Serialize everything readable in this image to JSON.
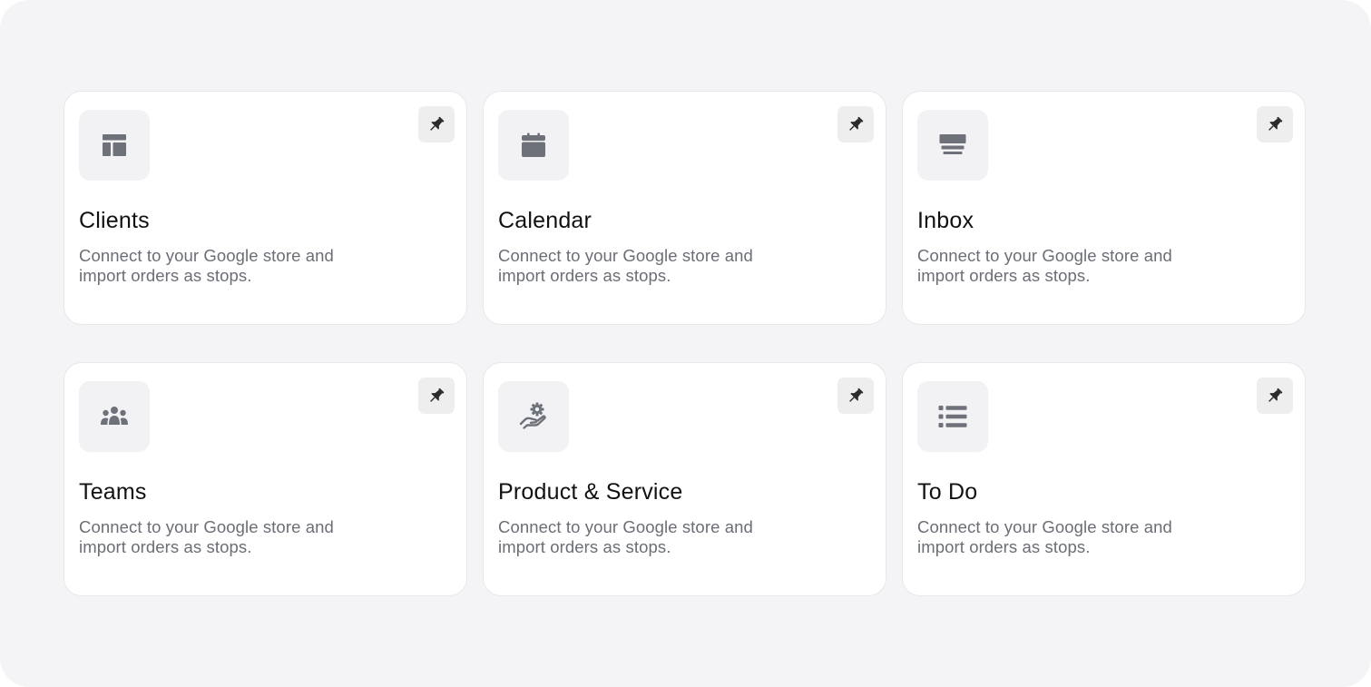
{
  "colors": {
    "background": "#f4f4f6",
    "card": "#ffffff",
    "icon": "#6e717a",
    "pin": "#2b2b2e"
  },
  "cards": [
    {
      "title": "Clients",
      "description": "Connect to your Google store and import orders as stops.",
      "icon": "layout-icon"
    },
    {
      "title": "Calendar",
      "description": "Connect to your Google store and import orders as stops.",
      "icon": "calendar-icon"
    },
    {
      "title": "Inbox",
      "description": "Connect to your Google store and import orders as stops.",
      "icon": "inbox-icon"
    },
    {
      "title": "Teams",
      "description": "Connect to your Google store and import orders as stops.",
      "icon": "users-icon"
    },
    {
      "title": "Product & Service",
      "description": "Connect to your Google store and import orders as stops.",
      "icon": "hand-gear-icon"
    },
    {
      "title": "To Do",
      "description": "Connect to your Google store and import orders as stops.",
      "icon": "list-icon"
    }
  ]
}
